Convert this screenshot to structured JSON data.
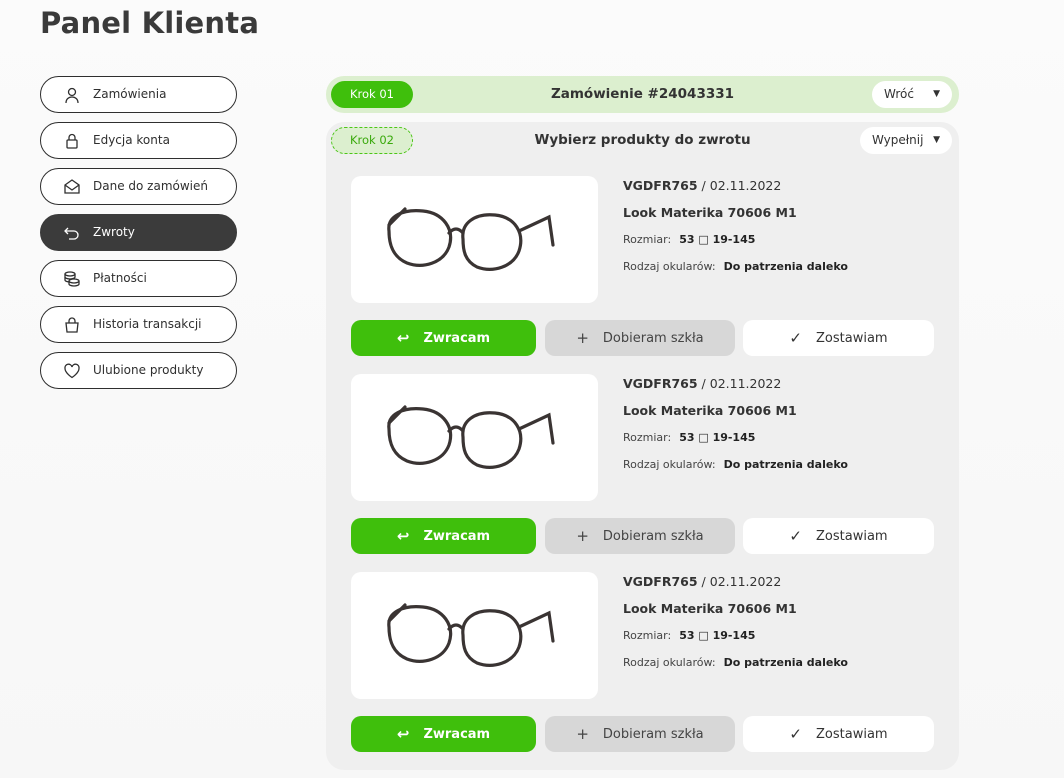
{
  "page_title": "Panel Klienta",
  "sidebar": {
    "items": [
      {
        "label": "Zamówienia",
        "icon": "user-icon"
      },
      {
        "label": "Edycja konta",
        "icon": "lock-icon"
      },
      {
        "label": "Dane do zamówień",
        "icon": "envelope-icon"
      },
      {
        "label": "Zwroty",
        "icon": "return-arrow-icon",
        "active": true
      },
      {
        "label": "Płatności",
        "icon": "coins-icon"
      },
      {
        "label": "Historia transakcji",
        "icon": "shopping-bag-icon"
      },
      {
        "label": "Ulubione produkty",
        "icon": "heart-icon"
      }
    ]
  },
  "step1": {
    "badge": "Krok 01",
    "title": "Zamówienie #24043331",
    "dropdown": "Wróć"
  },
  "step2": {
    "badge": "Krok 02",
    "title": "Wybierz produkty do zwrotu",
    "dropdown": "Wypełnij"
  },
  "products": [
    {
      "code": "VGDFR765",
      "date": " / 02.11.2022",
      "name": "Look Materika 70606 M1",
      "size_label": "Rozmiar:",
      "size_value": "53 □ 19-145",
      "type_label": "Rodzaj okularów:",
      "type_value": "Do patrzenia daleko"
    },
    {
      "code": "VGDFR765",
      "date": " / 02.11.2022",
      "name": "Look Materika 70606 M1",
      "size_label": "Rozmiar:",
      "size_value": "53 □ 19-145",
      "type_label": "Rodzaj okularów:",
      "type_value": "Do patrzenia daleko"
    },
    {
      "code": "VGDFR765",
      "date": " / 02.11.2022",
      "name": "Look Materika 70606 M1",
      "size_label": "Rozmiar:",
      "size_value": "53 □ 19-145",
      "type_label": "Rodzaj okularów:",
      "type_value": "Do patrzenia daleko"
    }
  ],
  "actions": {
    "return": "Zwracam",
    "lenses": "Dobieram szkła",
    "keep": "Zostawiam"
  },
  "colors": {
    "accent": "#3fbf0c",
    "step1_bg": "#dcefcf",
    "sidebar_active": "#3b3b3b"
  }
}
